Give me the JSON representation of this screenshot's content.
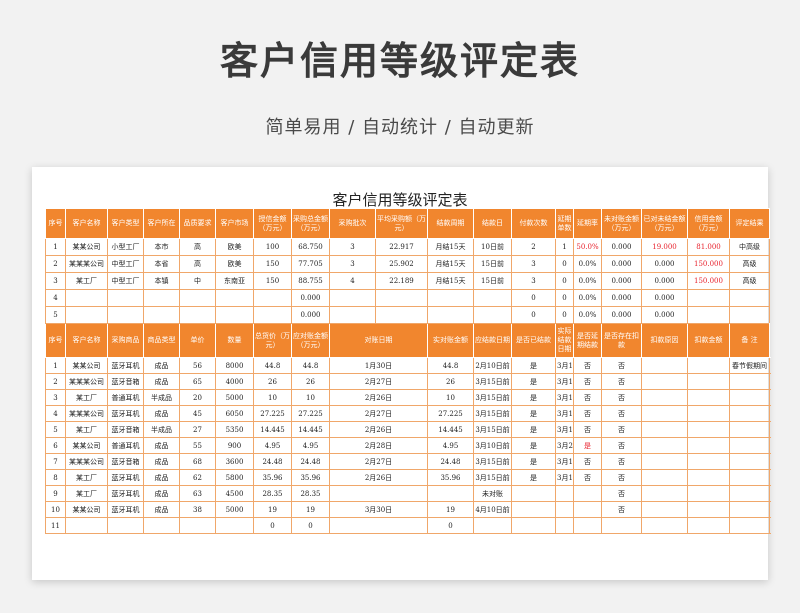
{
  "page": {
    "title": "客户信用等级评定表",
    "subtitle": "简单易用 / 自动统计 / 自动更新"
  },
  "sheet": {
    "title": "客户信用等级评定表",
    "table1": {
      "headers": [
        "序号",
        "客户名称",
        "客户类型",
        "客户所在",
        "品质要求",
        "客户市场",
        "授信金额（万元）",
        "采购总金额（万元）",
        "采购批次",
        "平均采购额（万元）",
        "结款周期",
        "结款日",
        "付款次数",
        "延期单数",
        "延期率",
        "未对账金额（万元）",
        "已对未结金额（万元）",
        "信用金额（万元）",
        "评定结果"
      ],
      "rows": [
        {
          "no": "1",
          "name": "某某公司",
          "type": "小型工厂",
          "loc": "本市",
          "quality": "高",
          "market": "欧美",
          "credit": "100",
          "total": "68.750",
          "batches": "3",
          "avg": "22.917",
          "cycle": "月结15天",
          "day": "10日前",
          "pays": "2",
          "delay": "1",
          "rate": "50.0%",
          "unrec": "0.000",
          "unsettled": "19.000",
          "credit_amt": "81.000",
          "grade": "中高级"
        },
        {
          "no": "2",
          "name": "某某某公司",
          "type": "中型工厂",
          "loc": "本省",
          "quality": "高",
          "market": "欧美",
          "credit": "150",
          "total": "77.705",
          "batches": "3",
          "avg": "25.902",
          "cycle": "月结15天",
          "day": "15日前",
          "pays": "3",
          "delay": "0",
          "rate": "0.0%",
          "unrec": "0.000",
          "unsettled": "0.000",
          "credit_amt": "150.000",
          "grade": "高级"
        },
        {
          "no": "3",
          "name": "某工厂",
          "type": "中型工厂",
          "loc": "本镇",
          "quality": "中",
          "market": "东南亚",
          "credit": "150",
          "total": "88.755",
          "batches": "4",
          "avg": "22.189",
          "cycle": "月结15天",
          "day": "15日前",
          "pays": "3",
          "delay": "0",
          "rate": "0.0%",
          "unrec": "0.000",
          "unsettled": "0.000",
          "credit_amt": "150.000",
          "grade": "高级"
        },
        {
          "no": "4",
          "name": "",
          "type": "",
          "loc": "",
          "quality": "",
          "market": "",
          "credit": "",
          "total": "0.000",
          "batches": "",
          "avg": "",
          "cycle": "",
          "day": "",
          "pays": "0",
          "delay": "0",
          "rate": "0.0%",
          "unrec": "0.000",
          "unsettled": "0.000",
          "credit_amt": "",
          "grade": ""
        },
        {
          "no": "5",
          "name": "",
          "type": "",
          "loc": "",
          "quality": "",
          "market": "",
          "credit": "",
          "total": "0.000",
          "batches": "",
          "avg": "",
          "cycle": "",
          "day": "",
          "pays": "0",
          "delay": "0",
          "rate": "0.0%",
          "unrec": "0.000",
          "unsettled": "0.000",
          "credit_amt": "",
          "grade": ""
        }
      ]
    },
    "table2": {
      "headers": [
        "序号",
        "客户名称",
        "采购商品",
        "商品类型",
        "单价",
        "数量",
        "总货价（万元）",
        "应对账金额（万元）",
        "对账日期",
        "实对账金额",
        "应结款日期",
        "是否已结款",
        "实际结款日期",
        "是否延期结款",
        "是否存在扣款",
        "扣款原因",
        "扣款金额",
        "备  注"
      ],
      "rows": [
        {
          "no": "1",
          "name": "某某公司",
          "item": "蓝牙耳机",
          "ptype": "成品",
          "price": "56",
          "qty": "8000",
          "total": "44.8",
          "due": "44.8",
          "date": "1月30日",
          "actual": "44.8",
          "settle": "2月10日前",
          "settled": "是",
          "actual_date": "3月1日",
          "late": "否",
          "deduct": "否",
          "reason": "",
          "amount": "",
          "note": "春节假期间"
        },
        {
          "no": "2",
          "name": "某某某公司",
          "item": "蓝牙音箱",
          "ptype": "成品",
          "price": "65",
          "qty": "4000",
          "total": "26",
          "due": "26",
          "date": "2月27日",
          "actual": "26",
          "settle": "3月15日前",
          "settled": "是",
          "actual_date": "3月12日",
          "late": "否",
          "deduct": "否",
          "reason": "",
          "amount": "",
          "note": ""
        },
        {
          "no": "3",
          "name": "某工厂",
          "item": "普通耳机",
          "ptype": "半成品",
          "price": "20",
          "qty": "5000",
          "total": "10",
          "due": "10",
          "date": "2月26日",
          "actual": "10",
          "settle": "3月15日前",
          "settled": "是",
          "actual_date": "3月12日",
          "late": "否",
          "deduct": "否",
          "reason": "",
          "amount": "",
          "note": ""
        },
        {
          "no": "4",
          "name": "某某某公司",
          "item": "蓝牙耳机",
          "ptype": "成品",
          "price": "45",
          "qty": "6050",
          "total": "27.225",
          "due": "27.225",
          "date": "2月27日",
          "actual": "27.225",
          "settle": "3月15日前",
          "settled": "是",
          "actual_date": "3月12日",
          "late": "否",
          "deduct": "否",
          "reason": "",
          "amount": "",
          "note": ""
        },
        {
          "no": "5",
          "name": "某工厂",
          "item": "蓝牙音箱",
          "ptype": "半成品",
          "price": "27",
          "qty": "5350",
          "total": "14.445",
          "due": "14.445",
          "date": "2月26日",
          "actual": "14.445",
          "settle": "3月15日前",
          "settled": "是",
          "actual_date": "3月12日",
          "late": "否",
          "deduct": "否",
          "reason": "",
          "amount": "",
          "note": ""
        },
        {
          "no": "6",
          "name": "某某公司",
          "item": "普通耳机",
          "ptype": "成品",
          "price": "55",
          "qty": "900",
          "total": "4.95",
          "due": "4.95",
          "date": "2月28日",
          "actual": "4.95",
          "settle": "3月10日前",
          "settled": "是",
          "actual_date": "3月20日",
          "late": "是",
          "deduct": "否",
          "reason": "",
          "amount": "",
          "note": ""
        },
        {
          "no": "7",
          "name": "某某某公司",
          "item": "蓝牙音箱",
          "ptype": "成品",
          "price": "68",
          "qty": "3600",
          "total": "24.48",
          "due": "24.48",
          "date": "2月27日",
          "actual": "24.48",
          "settle": "3月15日前",
          "settled": "是",
          "actual_date": "3月12日",
          "late": "否",
          "deduct": "否",
          "reason": "",
          "amount": "",
          "note": ""
        },
        {
          "no": "8",
          "name": "某工厂",
          "item": "蓝牙耳机",
          "ptype": "成品",
          "price": "62",
          "qty": "5800",
          "total": "35.96",
          "due": "35.96",
          "date": "2月26日",
          "actual": "35.96",
          "settle": "3月15日前",
          "settled": "是",
          "actual_date": "3月12日",
          "late": "否",
          "deduct": "否",
          "reason": "",
          "amount": "",
          "note": ""
        },
        {
          "no": "9",
          "name": "某工厂",
          "item": "蓝牙耳机",
          "ptype": "成品",
          "price": "63",
          "qty": "4500",
          "total": "28.35",
          "due": "28.35",
          "date": "",
          "actual": "",
          "settle": "未对账",
          "settled": "",
          "actual_date": "",
          "late": "",
          "deduct": "否",
          "reason": "",
          "amount": "",
          "note": ""
        },
        {
          "no": "10",
          "name": "某某公司",
          "item": "蓝牙耳机",
          "ptype": "成品",
          "price": "38",
          "qty": "5000",
          "total": "19",
          "due": "19",
          "date": "3月30日",
          "actual": "19",
          "settle": "4月10日前",
          "settled": "",
          "actual_date": "",
          "late": "",
          "deduct": "否",
          "reason": "",
          "amount": "",
          "note": ""
        },
        {
          "no": "11",
          "name": "",
          "item": "",
          "ptype": "",
          "price": "",
          "qty": "",
          "total": "0",
          "due": "0",
          "date": "",
          "actual": "0",
          "settle": "",
          "settled": "",
          "actual_date": "",
          "late": "",
          "deduct": "",
          "reason": "",
          "amount": "",
          "note": ""
        }
      ]
    }
  },
  "colors": {
    "header_bg": "#f1862e",
    "grid": "#f0a76a",
    "highlight": "#e8222d"
  }
}
